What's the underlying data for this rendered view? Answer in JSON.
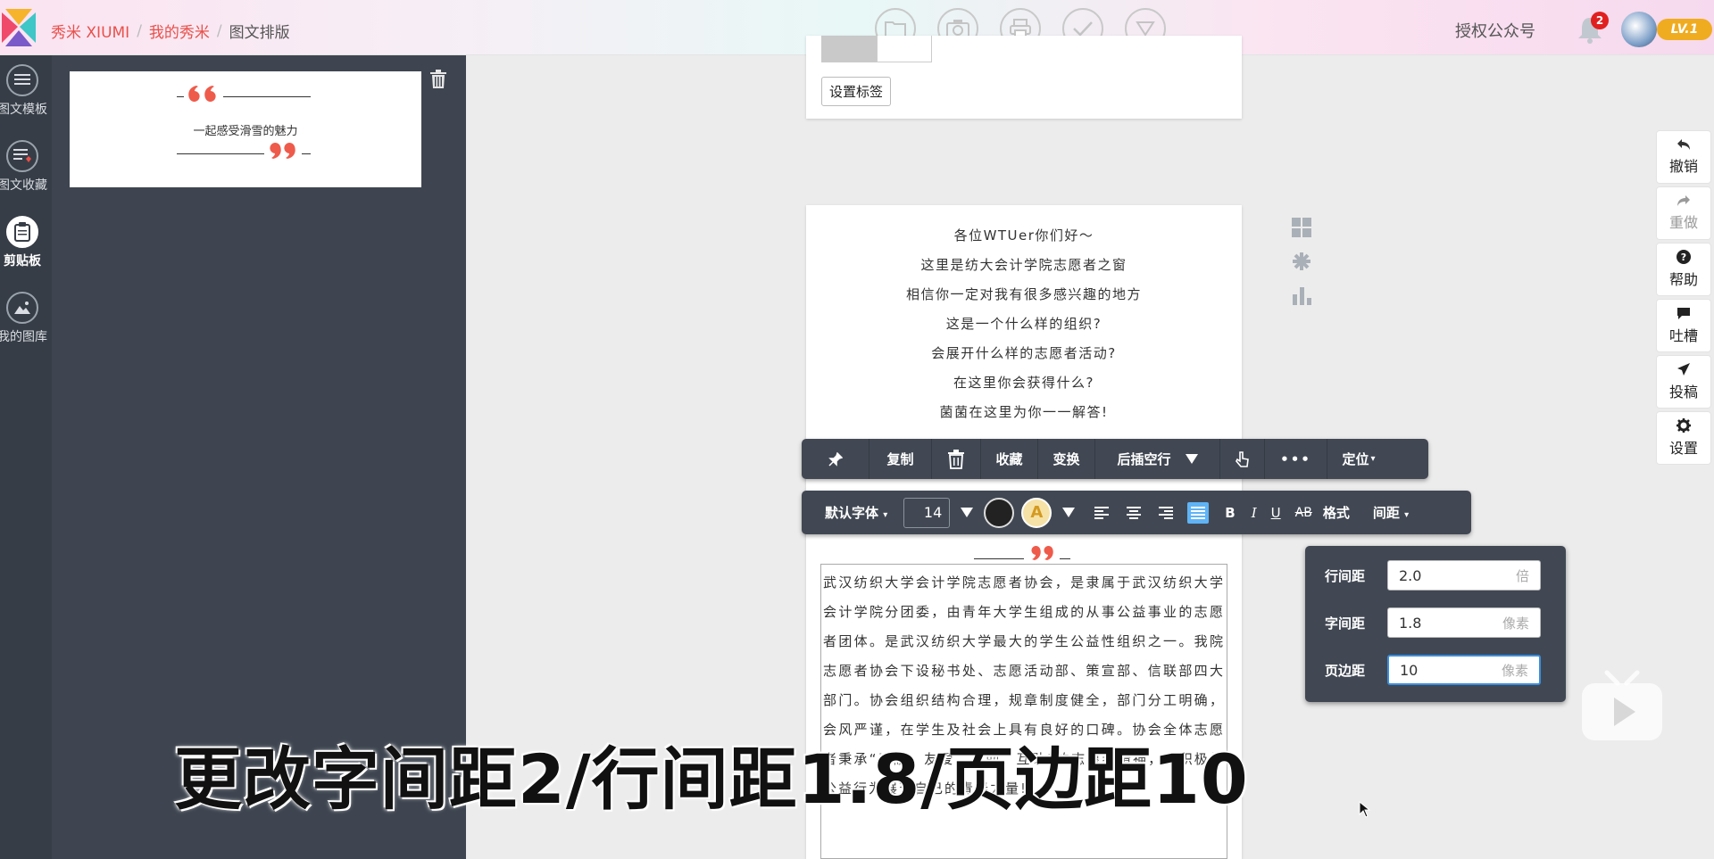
{
  "header": {
    "brand": "秀米 XIUMI",
    "breadcrumbs": [
      "我的秀米",
      "图文排版"
    ],
    "tools": [
      "folder-icon",
      "camera-icon",
      "print-icon",
      "check-icon",
      "triangle-down-icon"
    ],
    "authorize": "授权公众号",
    "notification_count": "2",
    "level": "LV.1"
  },
  "sidebar": {
    "items": [
      {
        "label": "图文模板",
        "icon": "list-icon"
      },
      {
        "label": "图文收藏",
        "icon": "list-heart-icon"
      },
      {
        "label": "剪贴板",
        "icon": "clipboard-icon"
      },
      {
        "label": "我的图库",
        "icon": "image-icon"
      }
    ]
  },
  "clipboard_item": {
    "text": "一起感受滑雪的魅力"
  },
  "card_top": {
    "tag_button": "设置标签"
  },
  "article": {
    "lines": [
      "各位WTUer你们好～",
      "这里是纺大会计学院志愿者之窗",
      "相信你一定对我有很多感兴趣的地方",
      "这是一个什么样的组织?",
      "会展开什么样的志愿者活动?",
      "在这里你会获得什么?",
      "菌菌在这里为你一一解答!"
    ],
    "paragraph": "武汉纺织大学会计学院志愿者协会，是隶属于武汉纺织大学会计学院分团委，由青年大学生组成的从事公益事业的志愿者团体。是武汉纺织大学最大的学生公益性组织之一。我院志愿者协会下设秘书处、志愿活动部、策宣部、信联部四大部门。协会组织结构合理，规章制度健全，部门分工明确，会风严谨，在学生及社会上具有良好的口碑。协会全体志愿者秉承“奉献、友爱、互助、互助”的志愿者精神，以积极的公益行为展现自己的青春力量!"
  },
  "toolbar1": {
    "copy": "复制",
    "collect": "收藏",
    "transform": "变换",
    "add_line_after": "后插空行",
    "more": "•••",
    "position": "定位"
  },
  "toolbar2": {
    "font": "默认字体",
    "size": "14",
    "bold": "B",
    "italic": "I",
    "underline": "U",
    "strike": "AB",
    "format": "格式",
    "spacing": "间距",
    "text_color": "#222222",
    "bg_glyph": "A"
  },
  "spacing_popup": {
    "line_height_label": "行间距",
    "line_height_value": "2.0",
    "line_height_unit": "倍",
    "letter_spacing_label": "字间距",
    "letter_spacing_value": "1.8",
    "letter_spacing_unit": "像素",
    "page_margin_label": "页边距",
    "page_margin_value": "10",
    "page_margin_unit": "像素"
  },
  "right_actions": [
    {
      "label": "撤销",
      "icon": "undo-icon"
    },
    {
      "label": "重做",
      "icon": "redo-icon"
    },
    {
      "label": "帮助",
      "icon": "help-icon"
    },
    {
      "label": "吐槽",
      "icon": "comment-icon"
    },
    {
      "label": "投稿",
      "icon": "send-icon"
    },
    {
      "label": "设置",
      "icon": "gear-icon"
    }
  ],
  "caption": "更改字间距2/行间距1.8/页边距10",
  "colors": {
    "brand_red": "#e8504a",
    "sidebar_bg": "#373d46",
    "toolbar_bg": "#414853",
    "accent_blue": "#5fb4f6",
    "level_orange": "#f0ac20"
  }
}
